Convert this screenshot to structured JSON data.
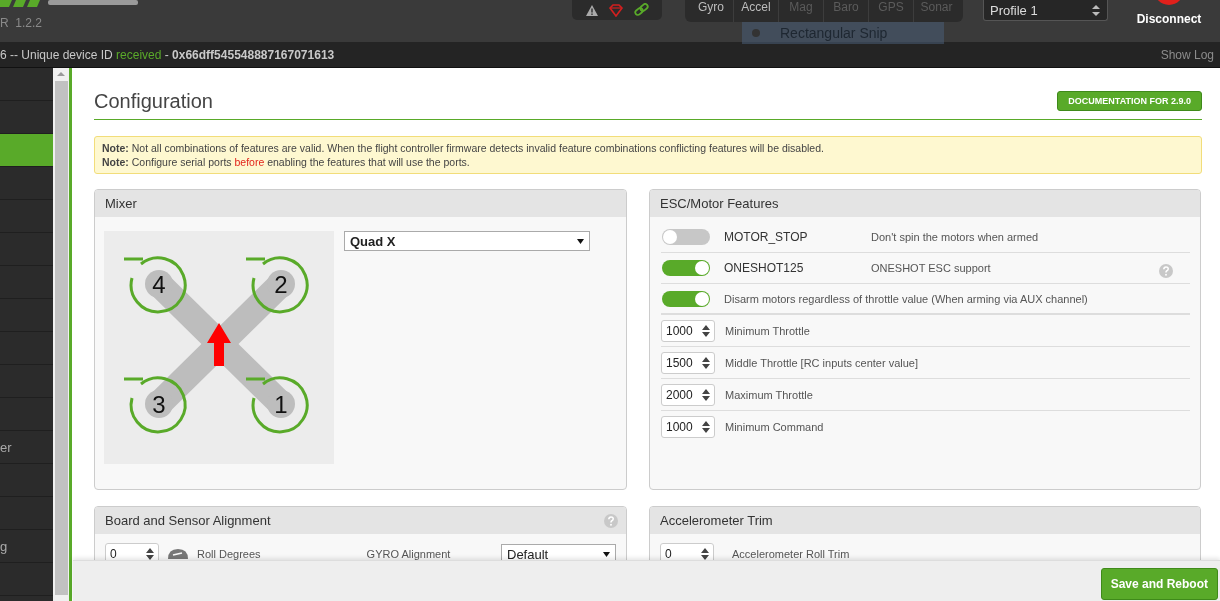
{
  "header": {
    "version": "R  1.2.2",
    "sensors": [
      {
        "label": "Gyro",
        "disabled": false
      },
      {
        "label": "Accel",
        "disabled": false
      },
      {
        "label": "Mag",
        "disabled": true
      },
      {
        "label": "Baro",
        "disabled": true
      },
      {
        "label": "GPS",
        "disabled": true
      },
      {
        "label": "Sonar",
        "disabled": true
      }
    ],
    "profile": "Profile 1",
    "disconnect": "Disconnect"
  },
  "snip_tooltip": "Rectangular Snip",
  "log": {
    "prefix": "6 -- Unique device ID",
    "status": "received",
    "separator": "-",
    "device_id": "0x66dff545548887167071613",
    "show_log": "Show Log"
  },
  "sidebar": {
    "items": [
      {
        "selected": false
      },
      {
        "selected": false
      },
      {
        "selected": true
      },
      {
        "selected": false
      },
      {
        "selected": false
      },
      {
        "selected": false
      },
      {
        "selected": false
      },
      {
        "selected": false
      },
      {
        "selected": false
      },
      {
        "selected": false
      },
      {
        "selected": false
      },
      {
        "label": "er",
        "selected": false
      },
      {
        "selected": false
      },
      {
        "selected": false
      },
      {
        "label": "g",
        "selected": false
      },
      {
        "selected": false
      }
    ]
  },
  "page": {
    "title": "Configuration",
    "doc_button": "DOCUMENTATION FOR 2.9.0",
    "notes": [
      [
        {
          "kind": "plain",
          "text": "**Note:** Not all combinations of features are valid. When the flight controller firmware detects invalid feature combinations conflicting features will be disabled."
        }
      ],
      [
        {
          "kind": "plain",
          "text": "**Note:** Configure serial ports "
        },
        {
          "kind": "warning",
          "text": "before"
        },
        {
          "kind": "plain",
          "text": " enabling the features that will use the ports."
        }
      ]
    ]
  },
  "mixer": {
    "title": "Mixer",
    "motors": [
      "4",
      "2",
      "3",
      "1"
    ],
    "mixer_type": "Quad X"
  },
  "esc": {
    "title": "ESC/Motor Features",
    "rows": [
      {
        "kind": "toggle",
        "on": false,
        "name": "MOTOR_STOP",
        "description": "Don't spin the motors when armed",
        "help": false
      },
      {
        "kind": "toggle",
        "on": true,
        "name": "ONESHOT125",
        "description": "ONESHOT ESC support",
        "help": true
      },
      {
        "kind": "toggle",
        "on": true,
        "description": "Disarm motors regardless of throttle value (When arming via AUX channel)",
        "help": false
      },
      {
        "kind": "number",
        "value": "1000",
        "label": "Minimum Throttle"
      },
      {
        "kind": "number",
        "value": "1500",
        "label": "Middle Throttle [RC inputs center value]"
      },
      {
        "kind": "number",
        "value": "2000",
        "label": "Maximum Throttle"
      },
      {
        "kind": "number",
        "value": "1000",
        "label": "Minimum Command"
      }
    ]
  },
  "board": {
    "title": "Board and Sensor Alignment",
    "help": true,
    "rows": [
      {
        "value": "0",
        "label": "Roll Degrees",
        "gyro_label": "GYRO Alignment",
        "gyro_value": "Default"
      }
    ]
  },
  "accel": {
    "title": "Accelerometer Trim",
    "rows": [
      {
        "value": "0",
        "label": "Accelerometer Roll Trim"
      }
    ]
  },
  "footer": {
    "save_button": "Save and Reboot"
  }
}
